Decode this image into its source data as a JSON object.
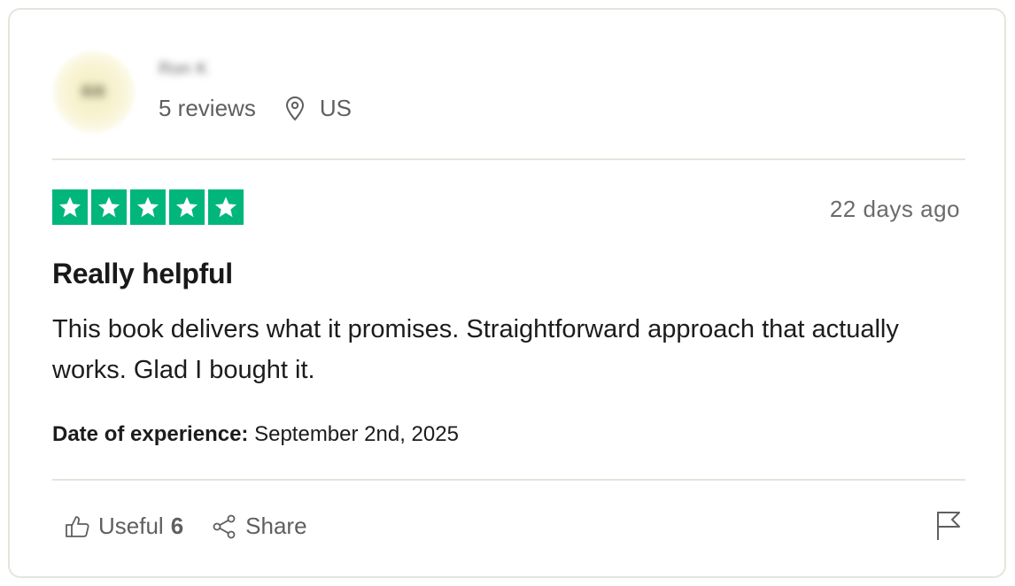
{
  "reviewer": {
    "initials": "RR",
    "name": "Ron K",
    "reviews_count": "5 reviews",
    "location": "US"
  },
  "rating": {
    "stars": 5,
    "max": 5,
    "color": "#00b67a"
  },
  "review": {
    "date_posted": "22 days ago",
    "title": "Really helpful",
    "body": "This book delivers what it promises. Straightforward approach that actually works. Glad I bought it.",
    "experience_label": "Date of experience:",
    "experience_date": "September 2nd, 2025"
  },
  "actions": {
    "useful_label": "Useful",
    "useful_count": "6",
    "share_label": "Share",
    "useful_icon": "thumbs-up-icon",
    "share_icon": "share-icon",
    "flag_icon": "flag-icon"
  }
}
